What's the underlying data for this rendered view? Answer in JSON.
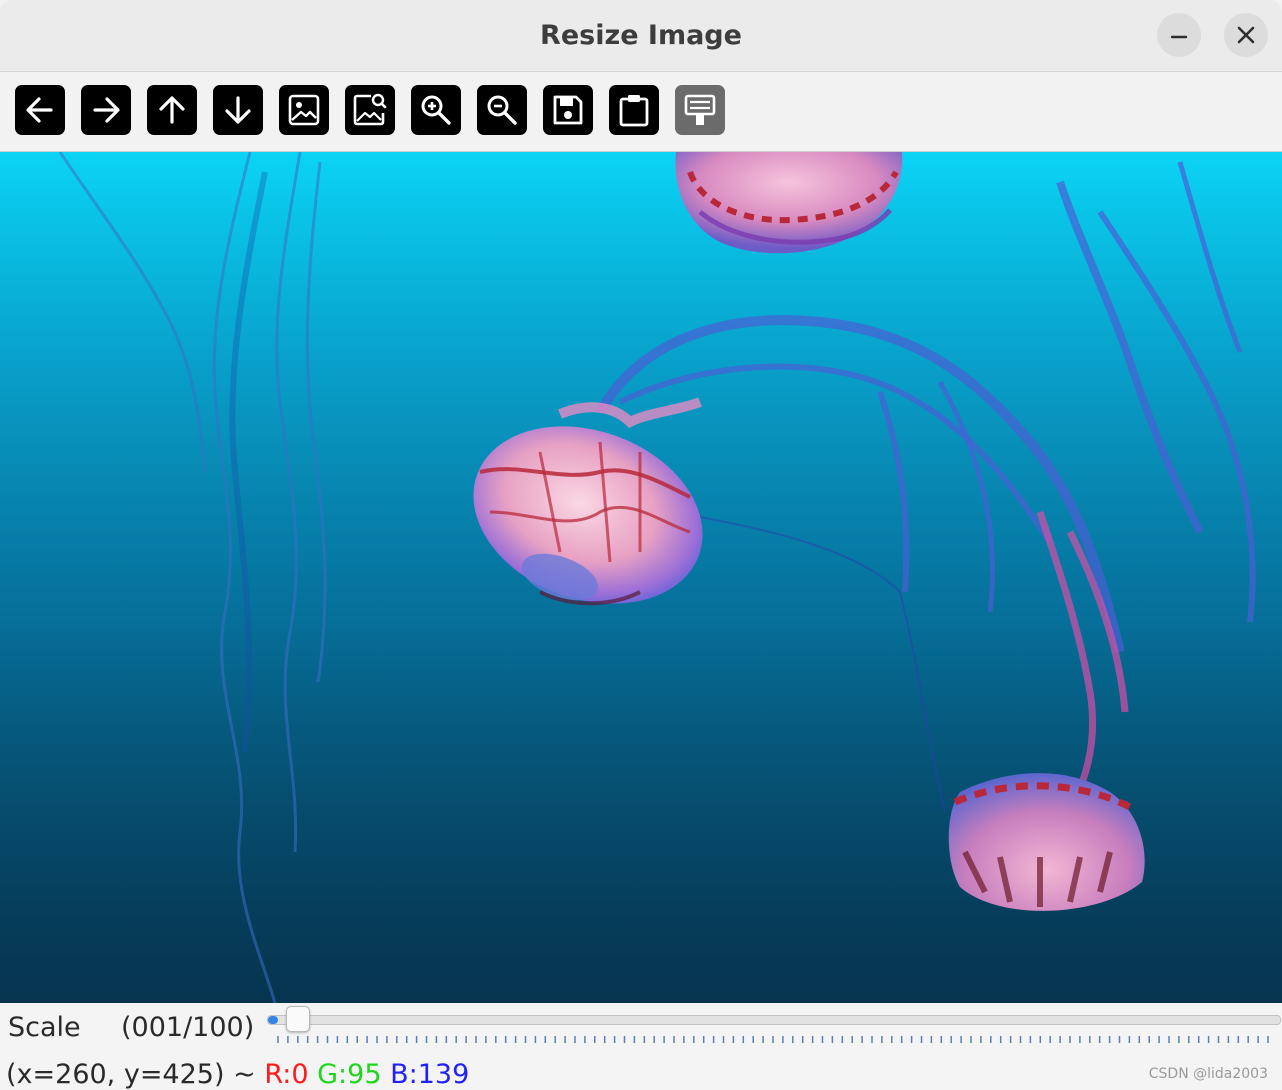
{
  "window": {
    "title": "Resize Image"
  },
  "window_controls": {
    "minimize_icon": "minimize-icon",
    "close_icon": "close-icon"
  },
  "toolbar": {
    "buttons": [
      {
        "icon": "arrow-left-icon",
        "enabled": true
      },
      {
        "icon": "arrow-right-icon",
        "enabled": true
      },
      {
        "icon": "arrow-up-icon",
        "enabled": true
      },
      {
        "icon": "arrow-down-icon",
        "enabled": true
      },
      {
        "icon": "image-icon",
        "enabled": true
      },
      {
        "icon": "image-search-icon",
        "enabled": true
      },
      {
        "icon": "zoom-in-icon",
        "enabled": true
      },
      {
        "icon": "zoom-out-icon",
        "enabled": true
      },
      {
        "icon": "save-icon",
        "enabled": true
      },
      {
        "icon": "clipboard-icon",
        "enabled": true
      },
      {
        "icon": "properties-icon",
        "enabled": false
      }
    ]
  },
  "image": {
    "subject": "jellyfish-photo",
    "colors": {
      "water_top": "#0bd4f5",
      "water_bottom": "#0b4e72",
      "jelly_pink": "#f0a8c8",
      "jelly_red": "#b8283a"
    }
  },
  "scale": {
    "label": "Scale",
    "value_text": "(001/100)",
    "value": 1,
    "max": 100
  },
  "status": {
    "coords": "(x=260, y=425) ~",
    "r": "R:0",
    "g": "G:95",
    "b": "B:139",
    "colors": {
      "r": "#ff1a1a",
      "g": "#1fd51f",
      "b": "#2020ff"
    }
  },
  "watermark": "CSDN @lida2003"
}
